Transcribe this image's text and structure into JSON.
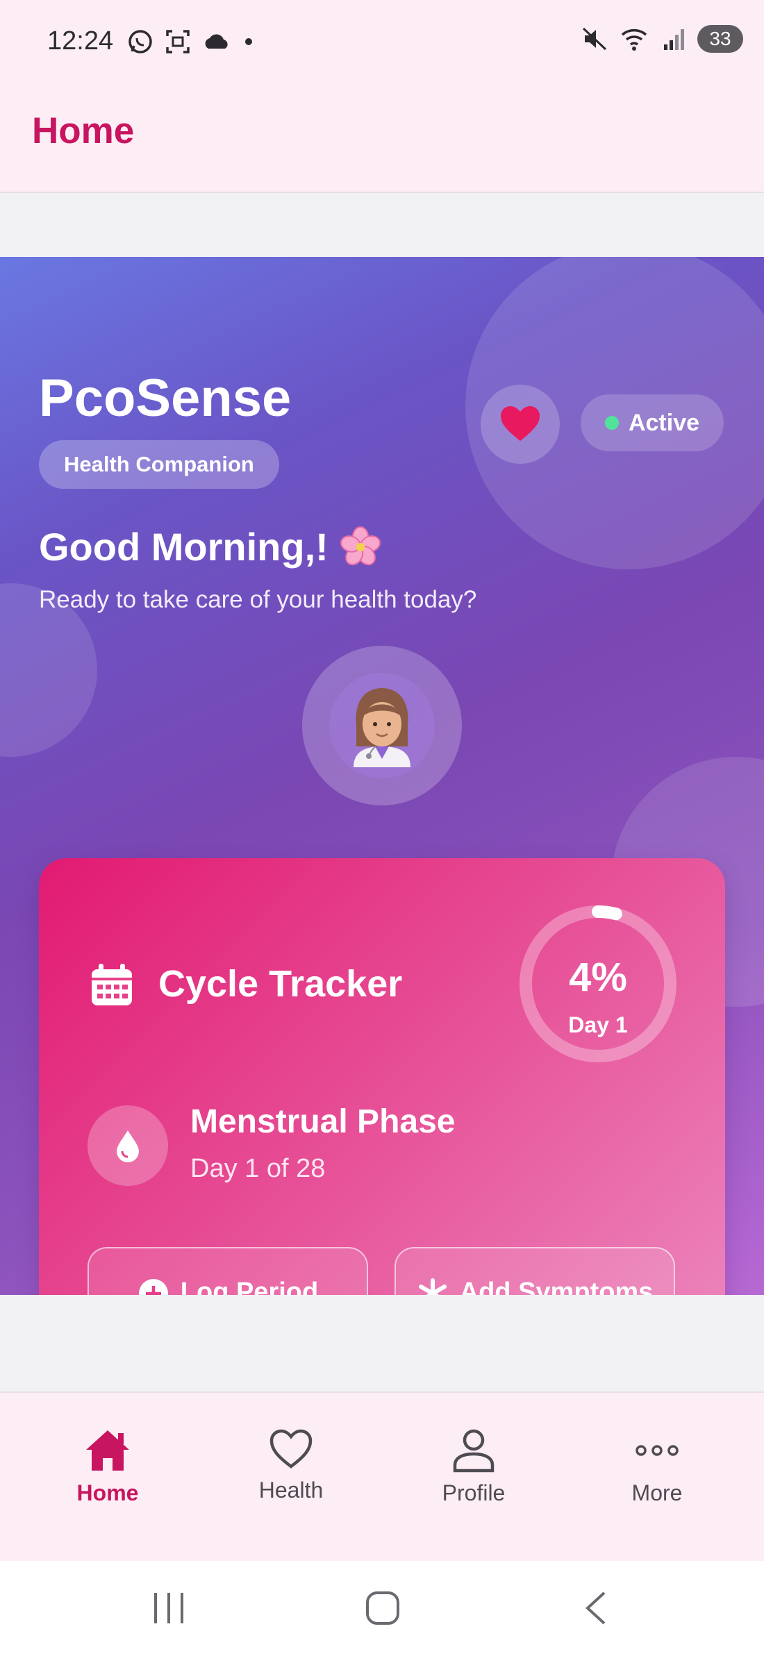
{
  "status_bar": {
    "time": "12:24",
    "battery": "33"
  },
  "app_bar": {
    "title": "Home"
  },
  "hero": {
    "brand": "PcoSense",
    "brand_tag": "Health Companion",
    "status_label": "Active",
    "greeting": "Good Morning,!",
    "subtitle": "Ready to take care of your health today?"
  },
  "cycle_card": {
    "title": "Cycle Tracker",
    "progress_percent_label": "4%",
    "progress_fraction": 0.04,
    "progress_day": "Day 1",
    "phase_title": "Menstrual Phase",
    "phase_day": "Day 1 of 28",
    "log_period_label": "Log Period",
    "add_symptoms_label": "Add Symptoms"
  },
  "bottom_nav": {
    "items": [
      {
        "label": "Home",
        "icon": "home-icon",
        "active": true
      },
      {
        "label": "Health",
        "icon": "heart-outline-icon",
        "active": false
      },
      {
        "label": "Profile",
        "icon": "person-icon",
        "active": false
      },
      {
        "label": "More",
        "icon": "more-dots-icon",
        "active": false
      }
    ]
  },
  "colors": {
    "accent": "#c8155f",
    "heart": "#e8195e",
    "active_dot": "#52e39b",
    "card_start": "#e21a72",
    "card_end": "#ec86bd"
  }
}
